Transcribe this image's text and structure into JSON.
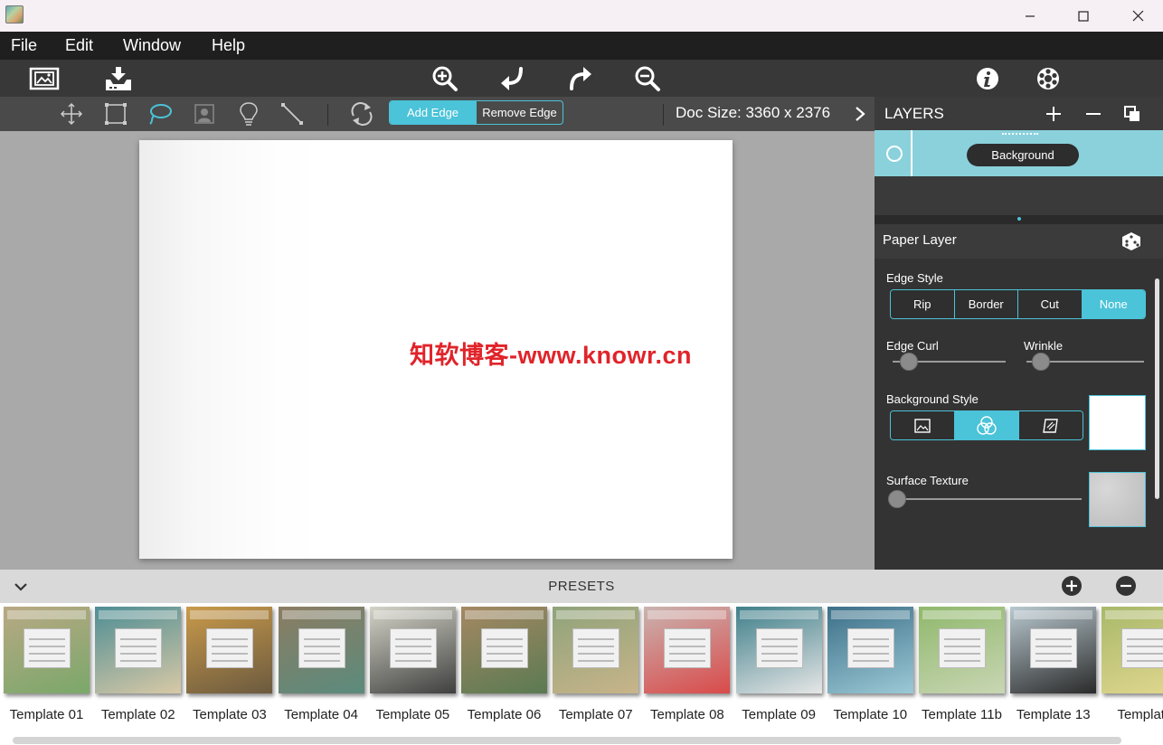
{
  "menu": [
    "File",
    "Edit",
    "Window",
    "Help"
  ],
  "toolstrip": {
    "add_edge_label": "Add Edge",
    "remove_edge_label": "Remove Edge",
    "doc_size": "Doc Size: 3360 x 2376"
  },
  "canvas": {
    "watermark": "知软博客-www.knowr.cn"
  },
  "layers": {
    "title": "LAYERS",
    "items": [
      {
        "name": "Background"
      }
    ]
  },
  "paper_layer": {
    "title": "Paper Layer",
    "edge_style_label": "Edge Style",
    "edge_styles": [
      "Rip",
      "Border",
      "Cut",
      "None"
    ],
    "edge_style_selected": "None",
    "edge_curl_label": "Edge Curl",
    "edge_curl_value": 0.08,
    "wrinkle_label": "Wrinkle",
    "wrinkle_value": 0.05,
    "background_style_label": "Background Style",
    "background_style_selected_index": 1,
    "surface_texture_label": "Surface Texture",
    "surface_texture_value": 0.0
  },
  "presets": {
    "title": "PRESETS",
    "items": [
      "Template 01",
      "Template 02",
      "Template 03",
      "Template 04",
      "Template 05",
      "Template 06",
      "Template 07",
      "Template 08",
      "Template 09",
      "Template 10",
      "Template 11b",
      "Template 13",
      "Template"
    ]
  },
  "colors": {
    "accent": "#4bc3d8",
    "menubar": "#1f1f1f",
    "toolbar": "#383838",
    "panel": "#333333",
    "canvas_bg": "#a9a9a9",
    "watermark": "#e0242a"
  }
}
